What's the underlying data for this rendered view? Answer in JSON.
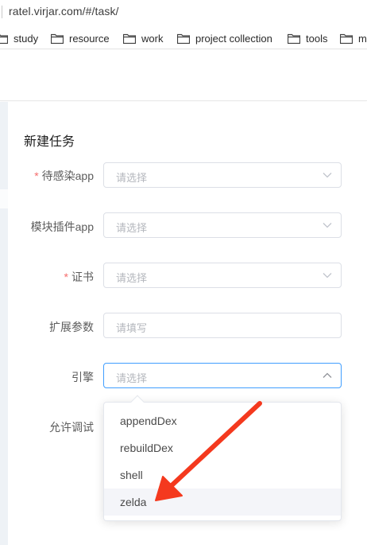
{
  "browser": {
    "url": "ratel.virjar.com/#/task/",
    "bookmarks": [
      {
        "label": "study",
        "icon": "folder-icon"
      },
      {
        "label": "resource",
        "icon": "folder-icon"
      },
      {
        "label": "work",
        "icon": "folder-icon"
      },
      {
        "label": "project collection",
        "icon": "folder-icon"
      },
      {
        "label": "tools",
        "icon": "folder-icon"
      },
      {
        "label": "m",
        "icon": "folder-icon"
      }
    ]
  },
  "form": {
    "title": "新建任务",
    "fields": [
      {
        "label": "待感染app",
        "required": true,
        "type": "select",
        "placeholder": "请选择"
      },
      {
        "label": "模块插件app",
        "required": false,
        "type": "select",
        "placeholder": "请选择"
      },
      {
        "label": "证书",
        "required": true,
        "type": "select",
        "placeholder": "请选择"
      },
      {
        "label": "扩展参数",
        "required": false,
        "type": "input",
        "placeholder": "请填写"
      },
      {
        "label": "引擎",
        "required": false,
        "type": "select",
        "placeholder": "请选择",
        "open": true
      },
      {
        "label": "允许调试",
        "required": false,
        "type": "switch"
      }
    ],
    "required_mark": "*",
    "engine_options": [
      "appendDex",
      "rebuildDex",
      "shell",
      "zelda"
    ],
    "hovered_option": "zelda"
  },
  "colors": {
    "required": "#f56c6c",
    "focus_border": "#409eff",
    "annotation_arrow": "#f4391e"
  }
}
